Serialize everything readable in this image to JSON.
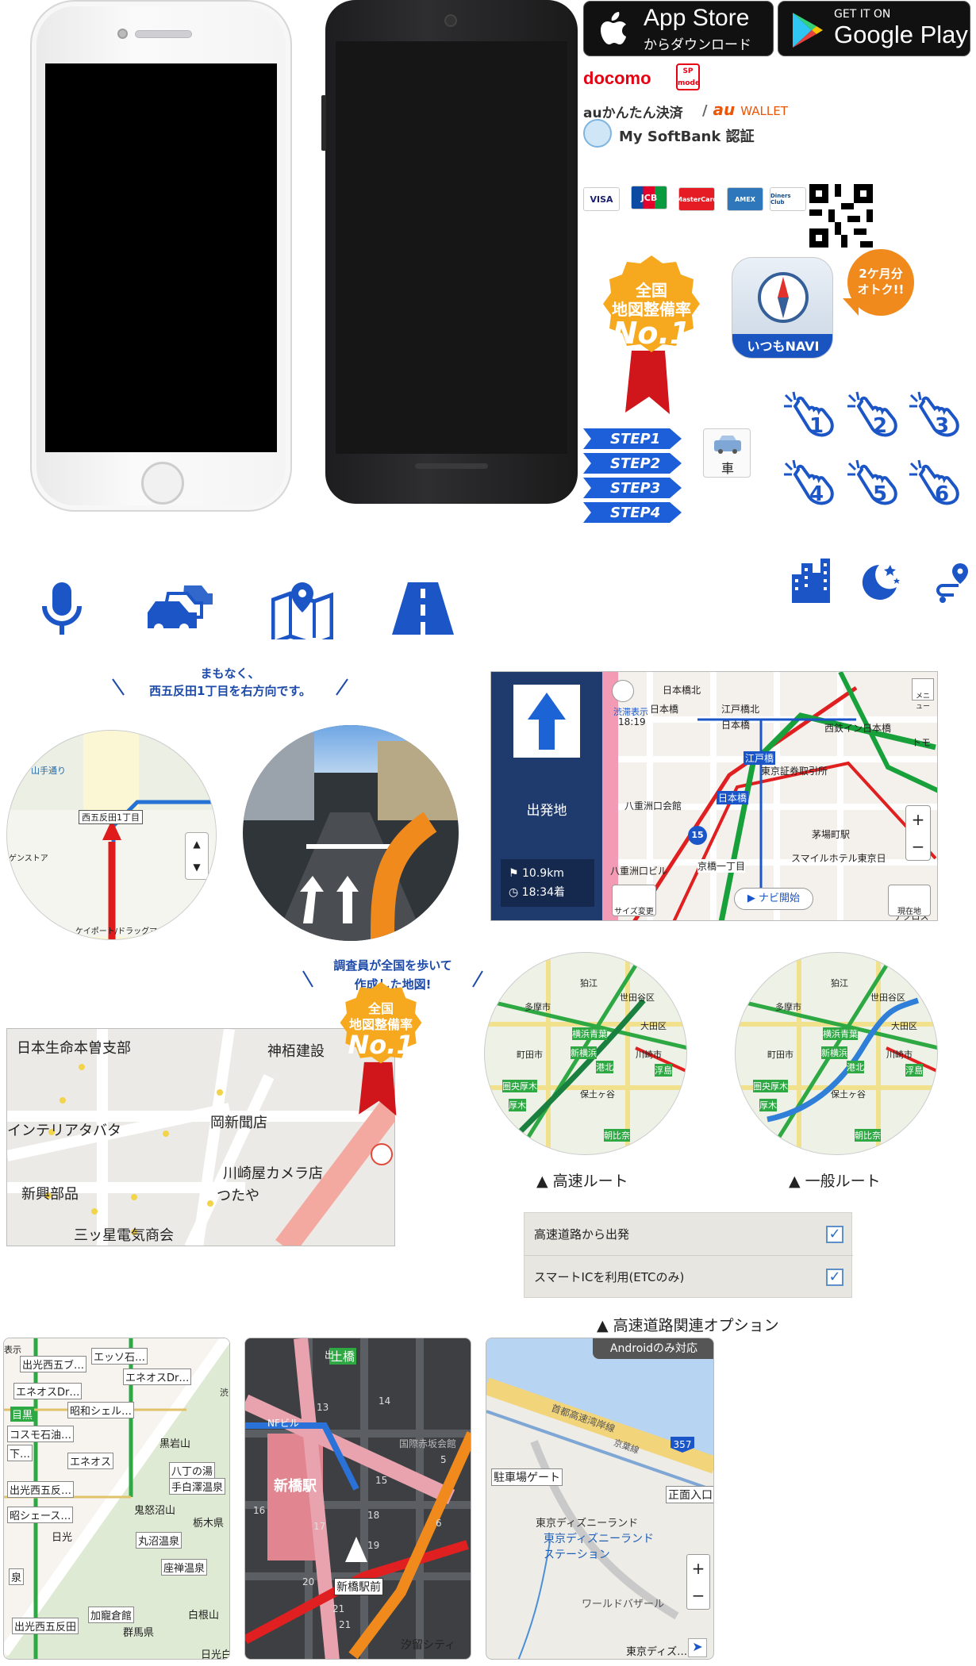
{
  "store": {
    "app_store_title": "App Store",
    "app_store_sub": "からダウンロード",
    "google_get": "GET IT ON",
    "google_title": "Google Play"
  },
  "carriers": {
    "docomo": "docomo",
    "spmode": "SP mode",
    "au_pay": "auかんたん決済",
    "au_wallet_prefix": "au",
    "au_wallet": "WALLET",
    "softbank": "My SoftBank 認証"
  },
  "cards": [
    "VISA",
    "JCB",
    "MasterCard",
    "AMEX",
    "Diners Club"
  ],
  "badge": {
    "line1": "全国",
    "line2": "地図整備率",
    "line3": "No.1"
  },
  "app_icon_label": "いつもNAVI",
  "promo": {
    "line1": "2ケ月分",
    "line2": "オトク!!"
  },
  "steps": [
    "STEP1",
    "STEP2",
    "STEP3",
    "STEP4"
  ],
  "car_label": "車",
  "hand_numbers": [
    "1",
    "2",
    "3",
    "4",
    "5",
    "6"
  ],
  "voice_guide": {
    "line1": "まもなく、",
    "line2": "西五反田1丁目を右方向です。"
  },
  "map1": {
    "road": "山手通り",
    "sign": "西五反田1丁目",
    "label_left": "ゲンストア",
    "label_bottom": "ケイポート/ドラッグマート"
  },
  "navi_screen": {
    "depart": "出発地",
    "distance": "10.9km",
    "arrival": "18:34着",
    "traffic_label": "渋滞表示",
    "time": "18:19",
    "menu": "メニュー",
    "size_btn": "サイズ変更",
    "start_btn": "▶ ナビ開始",
    "current_btn": "現在地",
    "route_num": "15",
    "labels": [
      "日本橋北",
      "江戸橋北",
      "日本橋",
      "江戸橋",
      "東京証券取引所",
      "八重洲口会館",
      "茅場町駅",
      "京橋一丁目",
      "スマイルホテル東京日",
      "八重洲口ビル",
      "日本橋",
      "日本橋",
      "西鉄イン日本橋",
      "トモ",
      "アクロス"
    ]
  },
  "survey": {
    "line1": "調査員が全国を歩いて",
    "line2": "作成した地図!"
  },
  "map_detail": {
    "labels": [
      "日本生命本曽支部",
      "神栢建設",
      "岡新聞店",
      "インテリアタバタ",
      "川崎屋カメラ店",
      "新興部品",
      "つたや",
      "三ッ星電気商会"
    ]
  },
  "route_maps": {
    "highway_caption": "▲ 高速ルート",
    "general_caption": "▲ 一般ルート",
    "labels_a": [
      "多摩市",
      "町田市",
      "横浜青葉",
      "圏央厚木",
      "港北",
      "新横浜",
      "保土ヶ谷",
      "朝比奈",
      "浮島",
      "川崎市",
      "大田区",
      "世田谷区",
      "狛江",
      "厚木"
    ],
    "labels_b": [
      "多摩市",
      "町田市",
      "横浜青葉",
      "圏央厚木",
      "港北",
      "新横浜",
      "保土ヶ谷",
      "朝比奈",
      "浮島",
      "川崎市",
      "大田区",
      "世田谷区",
      "狛江",
      "厚木"
    ]
  },
  "options": {
    "row1": "高速道路から出発",
    "row2": "スマートICを利用(ETCのみ)",
    "caption": "▲ 高速道路関連オプション"
  },
  "bottom_maps": {
    "a_labels": [
      "エッソ石…",
      "出光西五ブ…",
      "エネオスDr…",
      "エネオスDr…",
      "昭和シェル…",
      "目黒",
      "コスモ石油…",
      "エネオス",
      "出光西五反…",
      "昭シェース…",
      "八丁の湯",
      "手白澤温泉",
      "鬼怒沼山",
      "丸沼温泉",
      "座禅温泉",
      "加寵倉館",
      "群馬県",
      "白根山",
      "日光白",
      "栃木県",
      "黒岩山",
      "表示",
      "渋",
      "泉",
      "下…",
      "日光",
      "出光西五反田"
    ],
    "b_labels": [
      "土橋",
      "新橋駅",
      "新橋駅前",
      "汐留シティ",
      "国際赤坂会館",
      "出",
      "NFビル",
      "13",
      "5",
      "16",
      "17",
      "21",
      "20",
      "18",
      "14",
      "15",
      "6",
      "19",
      "21"
    ],
    "c_badge": "Androidのみ対応",
    "c_labels": [
      "駐車場ゲート",
      "正面入口",
      "東京ディズニーランド",
      "東京ディズニーランドステーション",
      "ワールドバザール",
      "東京ディズ…",
      "357",
      "首都高速湾岸線",
      "京葉線"
    ]
  }
}
